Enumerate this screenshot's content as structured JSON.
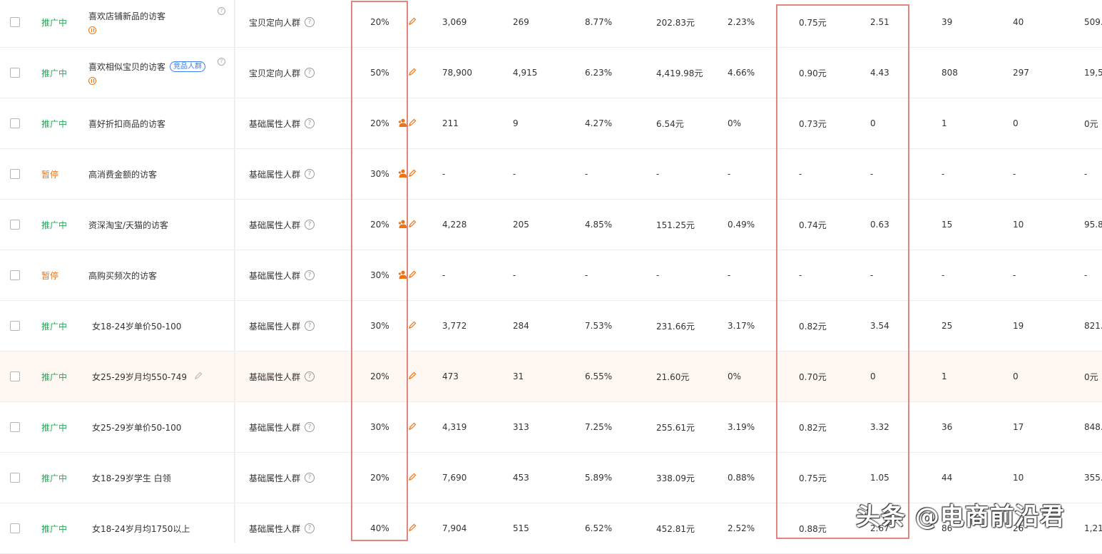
{
  "rows": [
    {
      "status": "推广中",
      "status_type": "on",
      "name": "喜欢店铺新品的访客",
      "tag": "",
      "paused_mark": true,
      "help_mark": true,
      "type": "宝贝定向人群",
      "premium": "20%",
      "person_icon": false,
      "show": "3,069",
      "click": "269",
      "ctr": "8.77%",
      "cost": "202.83元",
      "cvr": "2.23%",
      "cpc": "0.75元",
      "roi": "2.51",
      "fav": "39",
      "cart": "40",
      "gmv": "509."
    },
    {
      "status": "推广中",
      "status_type": "on",
      "name": "喜欢相似宝贝的访客",
      "tag": "竞品人群",
      "paused_mark": true,
      "help_mark": true,
      "type": "宝贝定向人群",
      "premium": "50%",
      "person_icon": false,
      "show": "78,900",
      "click": "4,915",
      "ctr": "6.23%",
      "cost": "4,419.98元",
      "cvr": "4.66%",
      "cpc": "0.90元",
      "roi": "4.43",
      "fav": "808",
      "cart": "297",
      "gmv": "19,5"
    },
    {
      "status": "推广中",
      "status_type": "on",
      "name": "喜好折扣商品的访客",
      "tag": "",
      "paused_mark": false,
      "help_mark": false,
      "type": "基础属性人群",
      "premium": "20%",
      "person_icon": true,
      "show": "211",
      "click": "9",
      "ctr": "4.27%",
      "cost": "6.54元",
      "cvr": "0%",
      "cpc": "0.73元",
      "roi": "0",
      "fav": "1",
      "cart": "0",
      "gmv": "0元"
    },
    {
      "status": "暂停",
      "status_type": "off",
      "name": "高消费金额的访客",
      "tag": "",
      "paused_mark": false,
      "help_mark": false,
      "type": "基础属性人群",
      "premium": "30%",
      "person_icon": true,
      "show": "-",
      "click": "-",
      "ctr": "-",
      "cost": "-",
      "cvr": "-",
      "cpc": "-",
      "roi": "-",
      "fav": "-",
      "cart": "-",
      "gmv": "-"
    },
    {
      "status": "推广中",
      "status_type": "on",
      "name": "资深淘宝/天猫的访客",
      "tag": "",
      "paused_mark": false,
      "help_mark": false,
      "type": "基础属性人群",
      "premium": "20%",
      "person_icon": true,
      "show": "4,228",
      "click": "205",
      "ctr": "4.85%",
      "cost": "151.25元",
      "cvr": "0.49%",
      "cpc": "0.74元",
      "roi": "0.63",
      "fav": "15",
      "cart": "10",
      "gmv": "95.8"
    },
    {
      "status": "暂停",
      "status_type": "off",
      "name": "高购买频次的访客",
      "tag": "",
      "paused_mark": false,
      "help_mark": false,
      "type": "基础属性人群",
      "premium": "30%",
      "person_icon": true,
      "show": "-",
      "click": "-",
      "ctr": "-",
      "cost": "-",
      "cvr": "-",
      "cpc": "-",
      "roi": "-",
      "fav": "-",
      "cart": "-",
      "gmv": "-"
    },
    {
      "status": "推广中",
      "status_type": "on",
      "name": "女18-24岁单价50-100",
      "tag": "",
      "paused_mark": false,
      "help_mark": false,
      "type": "基础属性人群",
      "premium": "30%",
      "person_icon": false,
      "show": "3,772",
      "click": "284",
      "ctr": "7.53%",
      "cost": "231.66元",
      "cvr": "3.17%",
      "cpc": "0.82元",
      "roi": "3.54",
      "fav": "25",
      "cart": "19",
      "gmv": "821."
    },
    {
      "status": "推广中",
      "status_type": "on",
      "name": "女25-29岁月均550-749",
      "tag": "",
      "paused_mark": false,
      "help_mark": false,
      "edit_mark": true,
      "highlight": true,
      "type": "基础属性人群",
      "premium": "20%",
      "person_icon": false,
      "show": "473",
      "click": "31",
      "ctr": "6.55%",
      "cost": "21.60元",
      "cvr": "0%",
      "cpc": "0.70元",
      "roi": "0",
      "fav": "1",
      "cart": "0",
      "gmv": "0元"
    },
    {
      "status": "推广中",
      "status_type": "on",
      "name": "女25-29岁单价50-100",
      "tag": "",
      "paused_mark": false,
      "help_mark": false,
      "type": "基础属性人群",
      "premium": "30%",
      "person_icon": false,
      "show": "4,319",
      "click": "313",
      "ctr": "7.25%",
      "cost": "255.61元",
      "cvr": "3.19%",
      "cpc": "0.82元",
      "roi": "3.32",
      "fav": "36",
      "cart": "17",
      "gmv": "848."
    },
    {
      "status": "推广中",
      "status_type": "on",
      "name": "女18-29岁学生 白领",
      "tag": "",
      "paused_mark": false,
      "help_mark": false,
      "type": "基础属性人群",
      "premium": "20%",
      "person_icon": false,
      "show": "7,690",
      "click": "453",
      "ctr": "5.89%",
      "cost": "338.09元",
      "cvr": "0.88%",
      "cpc": "0.75元",
      "roi": "1.05",
      "fav": "44",
      "cart": "10",
      "gmv": "355."
    },
    {
      "status": "推广中",
      "status_type": "on",
      "name": "女18-24岁月均1750以上",
      "tag": "",
      "paused_mark": false,
      "help_mark": false,
      "type": "基础属性人群",
      "premium": "40%",
      "person_icon": false,
      "show": "7,904",
      "click": "515",
      "ctr": "6.52%",
      "cost": "452.81元",
      "cvr": "2.52%",
      "cpc": "0.88元",
      "roi": "2.67",
      "fav": "86",
      "cart": "26",
      "gmv": "1,21"
    }
  ],
  "watermark": "头条 @电商前沿君",
  "colors": {
    "status_on": "#2ea35a",
    "status_off": "#f07312",
    "accent": "#f07312",
    "highlight_box": "#e2857c",
    "tag_blue": "#3c7df0"
  },
  "icons": {
    "edit": "pencil-icon",
    "person": "user-icon",
    "help": "question-circle-icon",
    "pause": "pause-circle-icon"
  }
}
